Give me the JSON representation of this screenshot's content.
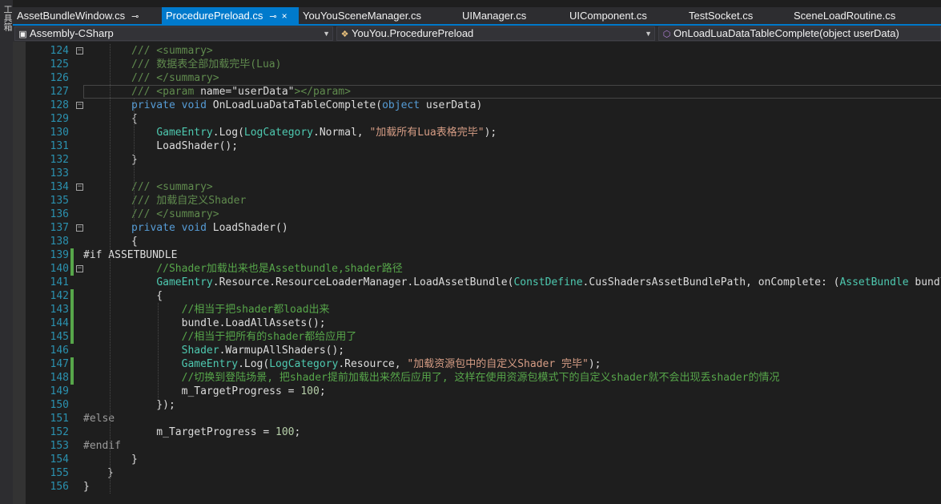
{
  "sidebar": {
    "tool_label": "工具箱"
  },
  "tabs": [
    {
      "label": "AssetBundleWindow.cs",
      "active": false,
      "pinned": true
    },
    {
      "label": "ProcedurePreload.cs",
      "active": true,
      "pinned": true,
      "close": "×"
    },
    {
      "label": "YouYouSceneManager.cs",
      "active": false
    },
    {
      "label": "UIManager.cs",
      "active": false
    },
    {
      "label": "UIComponent.cs",
      "active": false
    },
    {
      "label": "TestSocket.cs",
      "active": false
    },
    {
      "label": "SceneLoadRoutine.cs",
      "active": false
    }
  ],
  "nav": {
    "project": "Assembly-CSharp",
    "class": "YouYou.ProcedurePreload",
    "member": "OnLoadLuaDataTableComplete(object userData)"
  },
  "colors": {
    "accent": "#007acc",
    "keyword": "#569cd6",
    "comment": "#57a64a",
    "string": "#d69d85",
    "type": "#4ec9b0",
    "line_number": "#2b91af"
  },
  "current_line": 127,
  "lines": [
    {
      "n": "124",
      "fold": "⊟",
      "tokens": [
        {
          "t": "/// <summary>",
          "c": "xml"
        }
      ]
    },
    {
      "n": "125",
      "tokens": [
        {
          "t": "/// 数据表全部加载完毕(Lua)",
          "c": "xml"
        }
      ]
    },
    {
      "n": "126",
      "tokens": [
        {
          "t": "/// </summary>",
          "c": "xml"
        }
      ]
    },
    {
      "n": "127",
      "tokens": [
        {
          "t": "/// <param ",
          "c": "xml"
        },
        {
          "t": "name=",
          "c": "pl"
        },
        {
          "t": "\"userData\"",
          "c": "pl"
        },
        {
          "t": "></param>",
          "c": "xml"
        }
      ]
    },
    {
      "n": "128",
      "fold": "⊟",
      "tokens": [
        {
          "t": "private ",
          "c": "kw"
        },
        {
          "t": "void ",
          "c": "kw"
        },
        {
          "t": "OnLoadLuaDataTableComplete(",
          "c": "pl"
        },
        {
          "t": "object ",
          "c": "kw"
        },
        {
          "t": "userData)",
          "c": "pl"
        }
      ]
    },
    {
      "n": "129",
      "tokens": [
        {
          "t": "{",
          "c": "pl"
        }
      ]
    },
    {
      "n": "130",
      "tokens": [
        {
          "t": "    ",
          "c": "pl"
        },
        {
          "t": "GameEntry",
          "c": "ty"
        },
        {
          "t": ".Log(",
          "c": "pl"
        },
        {
          "t": "LogCategory",
          "c": "ty"
        },
        {
          "t": ".Normal, ",
          "c": "pl"
        },
        {
          "t": "\"加载所有Lua表格完毕\"",
          "c": "str"
        },
        {
          "t": ");",
          "c": "pl"
        }
      ]
    },
    {
      "n": "131",
      "tokens": [
        {
          "t": "    LoadShader();",
          "c": "pl"
        }
      ]
    },
    {
      "n": "132",
      "tokens": [
        {
          "t": "}",
          "c": "pl"
        }
      ]
    },
    {
      "n": "133",
      "tokens": []
    },
    {
      "n": "134",
      "fold": "⊟",
      "tokens": [
        {
          "t": "/// <summary>",
          "c": "xml"
        }
      ]
    },
    {
      "n": "135",
      "tokens": [
        {
          "t": "/// 加载自定义Shader",
          "c": "xml"
        }
      ]
    },
    {
      "n": "136",
      "tokens": [
        {
          "t": "/// </summary>",
          "c": "xml"
        }
      ]
    },
    {
      "n": "137",
      "fold": "⊟",
      "tokens": [
        {
          "t": "private ",
          "c": "kw"
        },
        {
          "t": "void ",
          "c": "kw"
        },
        {
          "t": "LoadShader()",
          "c": "pl"
        }
      ]
    },
    {
      "n": "138",
      "tokens": [
        {
          "t": "{",
          "c": "pl"
        }
      ]
    },
    {
      "n": "139",
      "indent": 0,
      "changed": true,
      "tokens": [
        {
          "t": "#if ASSETBUNDLE",
          "c": "pl"
        }
      ]
    },
    {
      "n": "140",
      "changed": true,
      "fold": "⊟",
      "tokens": [
        {
          "t": "    //Shader加载出来也是Assetbundle,shader路径",
          "c": "cm"
        }
      ]
    },
    {
      "n": "141",
      "tokens": [
        {
          "t": "    ",
          "c": "pl"
        },
        {
          "t": "GameEntry",
          "c": "ty"
        },
        {
          "t": ".Resource.ResourceLoaderManager.LoadAssetBundle(",
          "c": "pl"
        },
        {
          "t": "ConstDefine",
          "c": "ty"
        },
        {
          "t": ".CusShadersAssetBundlePath, onComplete: (",
          "c": "pl"
        },
        {
          "t": "AssetBundle",
          "c": "ty"
        },
        {
          "t": " bundle) =>",
          "c": "pl"
        }
      ]
    },
    {
      "n": "142",
      "changed": true,
      "tokens": [
        {
          "t": "    {",
          "c": "pl"
        }
      ]
    },
    {
      "n": "143",
      "changed": true,
      "tokens": [
        {
          "t": "        //相当于把shader都load出来",
          "c": "cm"
        }
      ]
    },
    {
      "n": "144",
      "changed": true,
      "tokens": [
        {
          "t": "        bundle.LoadAllAssets();",
          "c": "pl"
        }
      ]
    },
    {
      "n": "145",
      "changed": true,
      "tokens": [
        {
          "t": "        //相当于把所有的shader都给应用了",
          "c": "cm"
        }
      ]
    },
    {
      "n": "146",
      "tokens": [
        {
          "t": "        ",
          "c": "pl"
        },
        {
          "t": "Shader",
          "c": "ty"
        },
        {
          "t": ".WarmupAllShaders();",
          "c": "pl"
        }
      ]
    },
    {
      "n": "147",
      "changed": true,
      "tokens": [
        {
          "t": "        ",
          "c": "pl"
        },
        {
          "t": "GameEntry",
          "c": "ty"
        },
        {
          "t": ".Log(",
          "c": "pl"
        },
        {
          "t": "LogCategory",
          "c": "ty"
        },
        {
          "t": ".Resource, ",
          "c": "pl"
        },
        {
          "t": "\"加载资源包中的自定义Shader 完毕\"",
          "c": "str"
        },
        {
          "t": ");",
          "c": "pl"
        }
      ]
    },
    {
      "n": "148",
      "changed": true,
      "tokens": [
        {
          "t": "        //切换到登陆场景, 把shader提前加载出来然后应用了, 这样在使用资源包模式下的自定义shader就不会出现丢shader的情况",
          "c": "cm"
        }
      ]
    },
    {
      "n": "149",
      "tokens": [
        {
          "t": "        m_TargetProgress = ",
          "c": "pl"
        },
        {
          "t": "100",
          "c": "num"
        },
        {
          "t": ";",
          "c": "pl"
        }
      ]
    },
    {
      "n": "150",
      "tokens": [
        {
          "t": "    });",
          "c": "pl"
        }
      ]
    },
    {
      "n": "151",
      "indent": 0,
      "tokens": [
        {
          "t": "#else",
          "c": "pp"
        }
      ]
    },
    {
      "n": "152",
      "tokens": [
        {
          "t": "    m_TargetProgress = ",
          "c": "pl"
        },
        {
          "t": "100",
          "c": "num"
        },
        {
          "t": ";",
          "c": "pl"
        }
      ]
    },
    {
      "n": "153",
      "indent": 0,
      "tokens": [
        {
          "t": "#endif",
          "c": "pp"
        }
      ]
    },
    {
      "n": "154",
      "tokens": [
        {
          "t": "}",
          "c": "pl"
        }
      ]
    },
    {
      "n": "155",
      "indent": 1,
      "tokens": [
        {
          "t": "}",
          "c": "pl"
        }
      ]
    },
    {
      "n": "156",
      "indent": 0,
      "tokens": [
        {
          "t": "}",
          "c": "pl"
        }
      ]
    }
  ]
}
